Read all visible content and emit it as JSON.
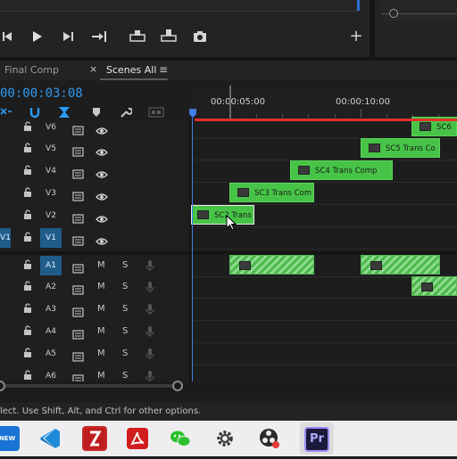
{
  "monitor": {
    "controls": [
      "◀|",
      "▶",
      "▶|",
      "→|",
      "insert",
      "overwrite",
      "camera"
    ],
    "add_label": "+"
  },
  "tabs": {
    "final_comp": "Final Comp",
    "close": "×",
    "scenes_all": "Scenes All",
    "menu": "≡"
  },
  "timecode": "00:00:03:08",
  "ruler": {
    "label_5s": "00:00:05:00",
    "label_10s": "00:00:10:00"
  },
  "video_tracks": [
    {
      "name": "V6",
      "target": ""
    },
    {
      "name": "V5",
      "target": ""
    },
    {
      "name": "V4",
      "target": ""
    },
    {
      "name": "V3",
      "target": ""
    },
    {
      "name": "V2",
      "target": ""
    },
    {
      "name": "V1",
      "target": "V1"
    }
  ],
  "source_v1": "V1",
  "audio_tracks": [
    {
      "name": "A1",
      "m": "M",
      "s": "S"
    },
    {
      "name": "A2",
      "m": "M",
      "s": "S"
    },
    {
      "name": "A3",
      "m": "M",
      "s": "S"
    },
    {
      "name": "A4",
      "m": "M",
      "s": "S"
    },
    {
      "name": "A5",
      "m": "M",
      "s": "S"
    },
    {
      "name": "A6",
      "m": "M",
      "s": "S"
    }
  ],
  "clips": {
    "v6": "SC6",
    "v5": "SC5 Trans Co",
    "v4": "SC4 Trans Comp",
    "v3": "SC3 Trans Com",
    "v2": "SC2 Trans"
  },
  "status_text": "lect. Use Shift, Alt, and Ctrl for other options.",
  "taskbar": {
    "items": [
      "ps-new",
      "vscode",
      "filezilla",
      "acrobat",
      "wechat",
      "settings",
      "obs",
      "premiere"
    ],
    "premiere_label": "Pr",
    "new_label": "NEW"
  },
  "colors": {
    "accent": "#2b9af3",
    "clip_green": "#47c447",
    "work_area": "#e5302c",
    "playhead": "#3f7fe6"
  }
}
